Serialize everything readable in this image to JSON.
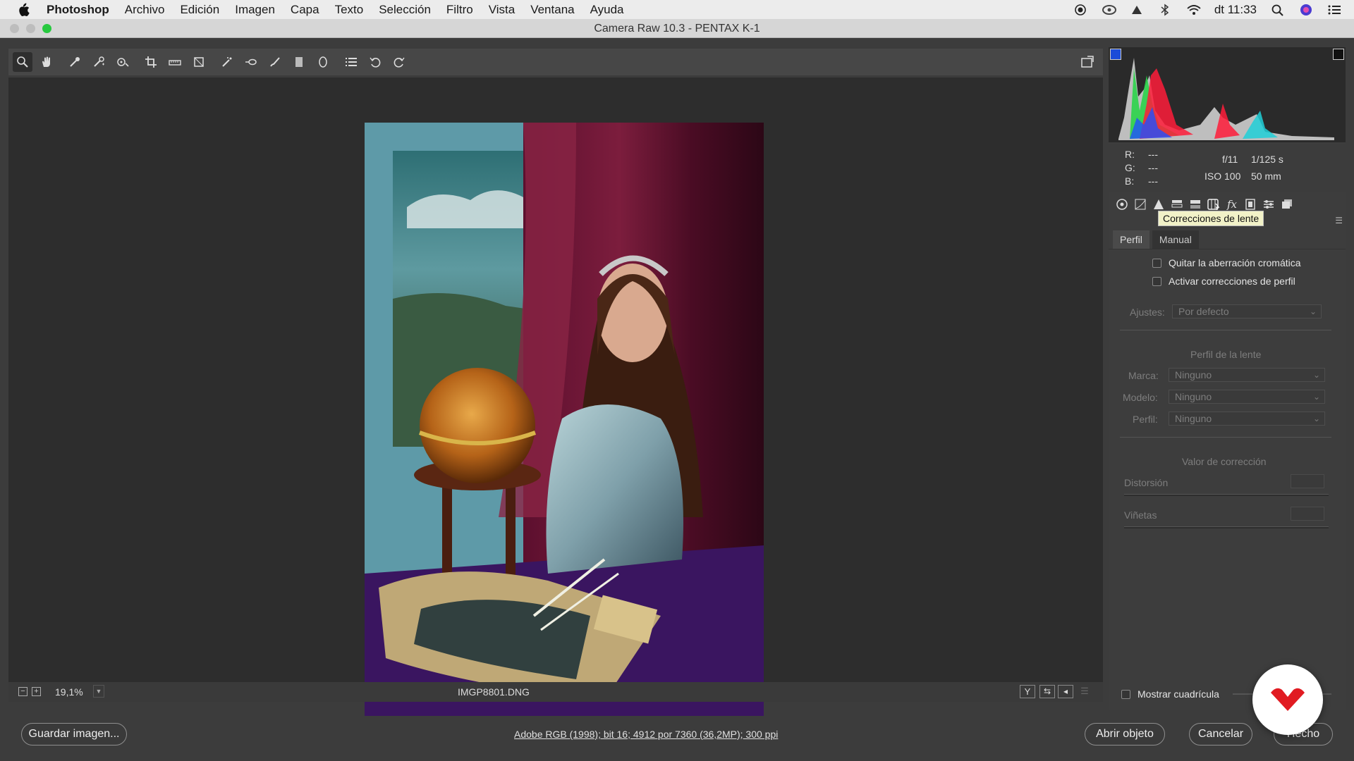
{
  "menubar": {
    "app": "Photoshop",
    "items": [
      "Archivo",
      "Edición",
      "Imagen",
      "Capa",
      "Texto",
      "Selección",
      "Filtro",
      "Vista",
      "Ventana",
      "Ayuda"
    ],
    "clock": "dt 11:33"
  },
  "window": {
    "title": "Camera Raw 10.3 -  PENTAX K-1"
  },
  "status": {
    "zoom": "19,1%",
    "filename": "IMGP8801.DNG"
  },
  "exif": {
    "r_label": "R:",
    "g_label": "G:",
    "b_label": "B:",
    "r": "---",
    "g": "---",
    "b": "---",
    "aperture": "f/11",
    "shutter": "1/125 s",
    "iso": "ISO 100",
    "focal": "50 mm"
  },
  "tooltip": "Correcciones de lente",
  "tabs": {
    "perfil": "Perfil",
    "manual": "Manual"
  },
  "checks": {
    "ca": "Quitar la aberración cromática",
    "profile": "Activar correcciones de perfil",
    "grid": "Mostrar cuadrícula"
  },
  "ajustes": {
    "label": "Ajustes:",
    "value": "Por defecto"
  },
  "lens_profile": {
    "heading": "Perfil de la lente",
    "marca_label": "Marca:",
    "marca": "Ninguno",
    "modelo_label": "Modelo:",
    "modelo": "Ninguno",
    "perfil_label": "Perfil:",
    "perfil": "Ninguno"
  },
  "correction": {
    "heading": "Valor de corrección",
    "distortion": "Distorsión",
    "vignette": "Viñetas"
  },
  "bottom": {
    "save": "Guardar imagen...",
    "info": "Adobe RGB (1998); bit 16; 4912 por 7360 (36,2MP); 300 ppi",
    "open": "Abrir objeto",
    "cancel": "Cancelar",
    "done": "Hecho"
  }
}
